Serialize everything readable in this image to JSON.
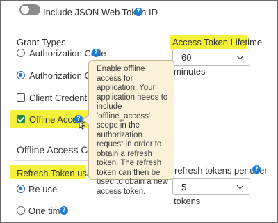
{
  "top": {
    "toggle_label": "Include JSON Web Token ID"
  },
  "grant_types": {
    "heading": "Grant Types",
    "items": [
      {
        "label": "Authorization Code",
        "control": "radio",
        "checked": false
      },
      {
        "label": "Authorization Code",
        "control": "radio",
        "checked": true
      },
      {
        "label": "Client Credentials",
        "control": "checkbox",
        "checked": false
      },
      {
        "label": "Offline Access",
        "control": "checkbox",
        "checked": true
      }
    ]
  },
  "access_token": {
    "label": "Access Token Lifetime",
    "value": "60",
    "unit": "minutes"
  },
  "tooltip": {
    "text": "Enable offline access for application. Your application needs to include 'offline_access' scope in the authorization request in order to obtain a refresh token. The refresh token can then be used to obain a new access token."
  },
  "offline_section": {
    "heading": "Offline Access Confi",
    "refresh_usage_label": "Refresh Token usage",
    "options": [
      {
        "label": "Re use",
        "checked": true
      },
      {
        "label": "One time",
        "checked": false
      }
    ],
    "refresh_per_user_label": "refresh tokens per user",
    "refresh_per_user_value": "5",
    "refresh_per_user_unit": "tokens"
  },
  "colors": {
    "highlight": "#f4f13a",
    "accent": "#1e6fd9",
    "tooltip_bg": "#fbf1d8",
    "checked_green": "#1f8a3a"
  },
  "icons": {
    "help": "question-circle-icon",
    "dropdown": "chevron-down-icon",
    "cursor": "mouse-pointer-icon"
  }
}
